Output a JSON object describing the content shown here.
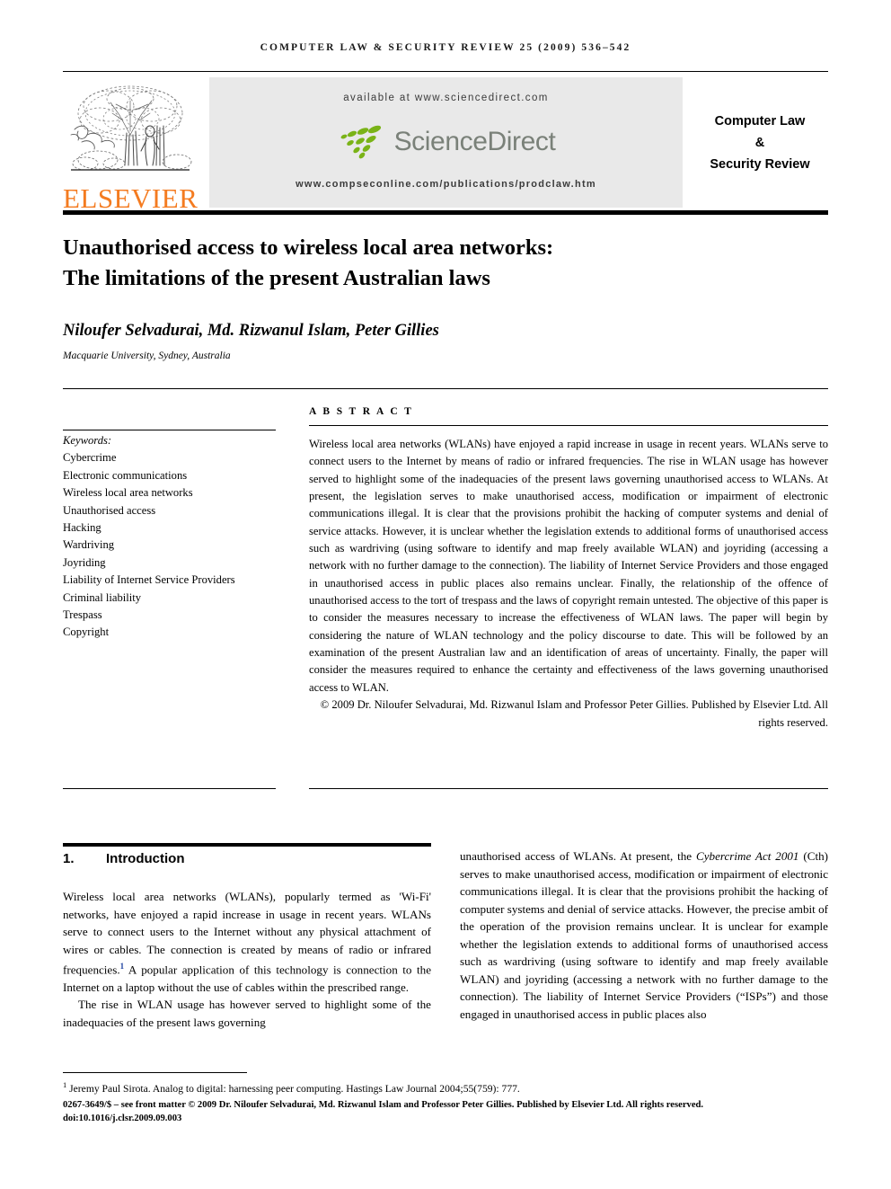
{
  "running_head": "COMPUTER LAW & SECURITY REVIEW 25 (2009) 536–542",
  "masthead": {
    "publisher_name": "ELSEVIER",
    "tree_logo_name": "elsevier-tree-logo",
    "available_at": "available at www.sciencedirect.com",
    "sciencedirect_logo_text": "ScienceDirect",
    "journal_url": "www.compseconline.com/publications/prodclaw.htm",
    "journal_title_line1": "Computer Law",
    "journal_title_line2": "&",
    "journal_title_line3": "Security Review",
    "colors": {
      "elsevier_orange": "#f47b20",
      "sciencedirect_green": "#7ab317",
      "sciencedirect_gray": "#7a8179",
      "banner_gray": "#e9e9e9"
    }
  },
  "article": {
    "title_line1": "Unauthorised access to wireless local area networks:",
    "title_line2": "The limitations of the present Australian laws",
    "authors": "Niloufer Selvadurai, Md. Rizwanul Islam, Peter Gillies",
    "affiliation": "Macquarie University, Sydney, Australia"
  },
  "keywords": {
    "heading": "Keywords:",
    "items": [
      "Cybercrime",
      "Electronic communications",
      "Wireless local area networks",
      "Unauthorised access",
      "Hacking",
      "Wardriving",
      "Joyriding",
      "Liability of Internet Service Providers",
      "Criminal liability",
      "Trespass",
      "Copyright"
    ]
  },
  "abstract": {
    "label": "A B S T R A C T",
    "body": "Wireless local area networks (WLANs) have enjoyed a rapid increase in usage in recent years. WLANs serve to connect users to the Internet by means of radio or infrared frequencies. The rise in WLAN usage has however served to highlight some of the inadequacies of the present laws governing unauthorised access to WLANs. At present, the legislation serves to make unauthorised access, modification or impairment of electronic communications illegal. It is clear that the provisions prohibit the hacking of computer systems and denial of service attacks. However, it is unclear whether the legislation extends to additional forms of unauthorised access such as wardriving (using software to identify and map freely available WLAN) and joyriding (accessing a network with no further damage to the connection). The liability of Internet Service Providers and those engaged in unauthorised access in public places also remains unclear. Finally, the relationship of the offence of unauthorised access to the tort of trespass and the laws of copyright remain untested. The objective of this paper is to consider the measures necessary to increase the effectiveness of WLAN laws. The paper will begin by considering the nature of WLAN technology and the policy discourse to date. This will be followed by an examination of the present Australian law and an identification of areas of uncertainty. Finally, the paper will consider the measures required to enhance the certainty and effectiveness of the laws governing unauthorised access to WLAN.",
    "copyright": "© 2009 Dr. Niloufer Selvadurai, Md. Rizwanul Islam and Professor Peter Gillies. Published by Elsevier Ltd. All rights reserved."
  },
  "section": {
    "number": "1.",
    "heading": "Introduction",
    "left_para_1_a": "Wireless local area networks (WLANs), popularly termed as 'Wi-Fi' networks, have enjoyed a rapid increase in usage in recent years. WLANs serve to connect users to the Internet without any physical attachment of wires or cables. The connection is created by means of radio or infrared frequencies.",
    "left_para_1_marker": "1",
    "left_para_1_b": " A popular application of this technology is connection to the Internet on a laptop without the use of cables within the prescribed range.",
    "left_para_2": "The rise in WLAN usage has however served to highlight some of the inadequacies of the present laws governing",
    "right_para_a": "unauthorised access of WLANs. At present, the ",
    "right_para_italic": "Cybercrime Act 2001",
    "right_para_b": " (Cth) serves to make unauthorised access, modification or impairment of electronic communications illegal. It is clear that the provisions prohibit the hacking of computer systems and denial of service attacks. However, the precise ambit of the operation of the provision remains unclear. It is unclear for example whether the legislation extends to additional forms of unauthorised access such as wardriving (using software to identify and map freely available WLAN) and joyriding (accessing a network with no further damage to the connection). The liability of Internet Service Providers (“ISPs”) and those engaged in unauthorised access in public places also"
  },
  "footnote": {
    "marker": "1",
    "text": " Jeremy Paul Sirota. Analog to digital: harnessing peer computing. Hastings Law Journal 2004;55(759): 777."
  },
  "footer": {
    "line1": "0267-3649/$ – see front matter © 2009 Dr. Niloufer Selvadurai, Md. Rizwanul Islam and Professor Peter Gillies. Published by Elsevier Ltd. All rights reserved.",
    "line2": "doi:10.1016/j.clsr.2009.09.003"
  }
}
